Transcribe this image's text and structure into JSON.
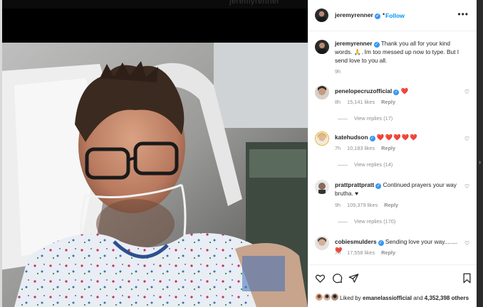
{
  "photo": {
    "top_strip_text": "jeremyrenner"
  },
  "post_header": {
    "username": "jeremyrenner",
    "follow_label": "Follow",
    "more_icon": "more-horizontal-icon"
  },
  "caption": {
    "username": "jeremyrenner",
    "text": "Thank you all for your kind words. 🙏. Im too messed up now to type. But I send love to you all.",
    "time": "9h"
  },
  "comments": [
    {
      "username": "penelopecruzofficial",
      "text": "❤️",
      "time": "8h",
      "likes": "15,141 likes",
      "reply_label": "Reply",
      "view_replies": "View replies (17)"
    },
    {
      "username": "katehudson",
      "text": "❤️❤️❤️❤️❤️",
      "time": "7h",
      "likes": "10,183 likes",
      "reply_label": "Reply",
      "view_replies": "View replies (14)"
    },
    {
      "username": "prattprattpratt",
      "text": "Continued prayers your way brutha. ♥",
      "time": "9h",
      "likes": "109,379 likes",
      "reply_label": "Reply",
      "view_replies": "View replies (170)"
    },
    {
      "username": "cobiesmulders",
      "text": "Sending love your way........❤️",
      "time": "7h",
      "likes": "17,558 likes",
      "reply_label": "Reply"
    }
  ],
  "actions": {
    "like_icon": "heart-icon",
    "comment_icon": "comment-icon",
    "share_icon": "send-icon",
    "save_icon": "bookmark-icon"
  },
  "likes_summary": {
    "prefix": "Liked by",
    "user": "emanelassiofficial",
    "middle": "and",
    "count": "4,352,398 others"
  },
  "colors": {
    "link_blue": "#0095f6",
    "verified_blue": "#3897f0",
    "heart_red": "#e0001b",
    "meta_gray": "#8e8e8e"
  }
}
